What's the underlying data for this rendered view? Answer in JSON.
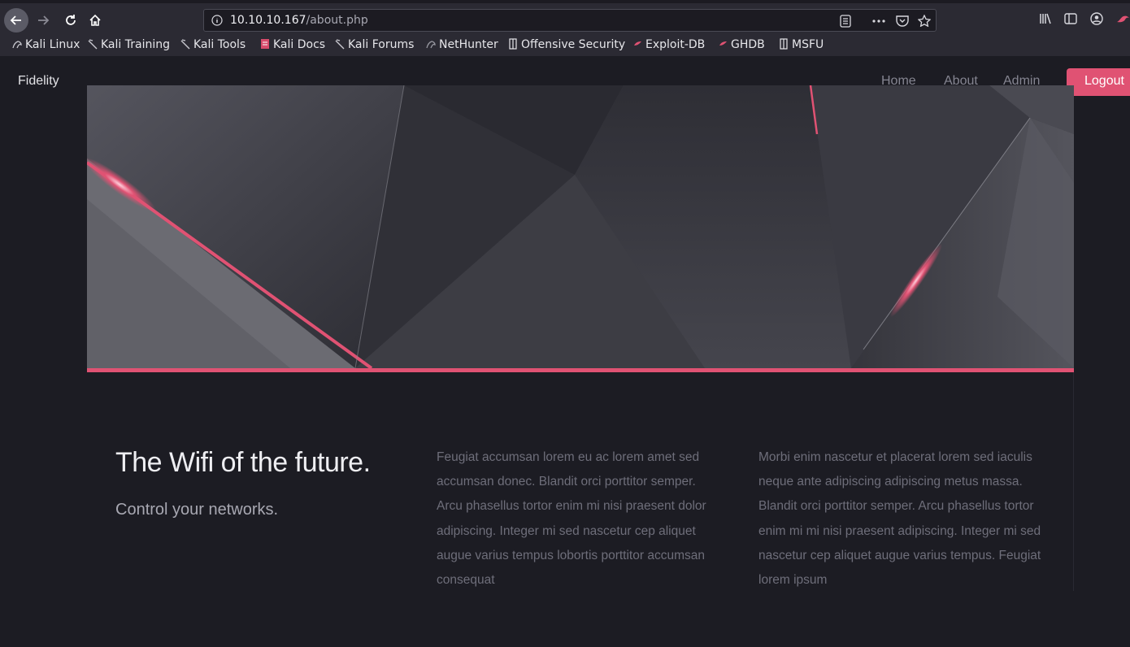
{
  "browser": {
    "url_host": "10.10.10.167",
    "url_path": "/about.php",
    "bookmarks": [
      {
        "label": "Kali Linux",
        "icon": "kali-dragon-icon"
      },
      {
        "label": "Kali Training",
        "icon": "kali-dragon-icon"
      },
      {
        "label": "Kali Tools",
        "icon": "kali-dragon-icon"
      },
      {
        "label": "Kali Docs",
        "icon": "kali-docs-icon"
      },
      {
        "label": "Kali Forums",
        "icon": "kali-dragon-icon"
      },
      {
        "label": "NetHunter",
        "icon": "nethunter-icon"
      },
      {
        "label": "Offensive Security",
        "icon": "offsec-icon"
      },
      {
        "label": "Exploit-DB",
        "icon": "exploit-db-icon"
      },
      {
        "label": "GHDB",
        "icon": "ghdb-icon"
      },
      {
        "label": "MSFU",
        "icon": "msfu-icon"
      }
    ]
  },
  "site": {
    "brand": "Fidelity",
    "nav": [
      "Home",
      "About",
      "Admin"
    ],
    "logout": "Logout",
    "accent": "#e05273"
  },
  "content": {
    "headline": "The Wifi of the future.",
    "subline": "Control your networks.",
    "paragraph1": "Feugiat accumsan lorem eu ac lorem amet sed accumsan donec. Blandit orci porttitor semper. Arcu phasellus tortor enim mi nisi praesent dolor adipiscing. Integer mi sed nascetur cep aliquet augue varius tempus lobortis porttitor accumsan consequat",
    "paragraph2": "Morbi enim nascetur et placerat lorem sed iaculis neque ante adipiscing adipiscing metus massa. Blandit orci porttitor semper. Arcu phasellus tortor enim mi mi nisi praesent adipiscing. Integer mi sed nascetur cep aliquet augue varius tempus. Feugiat lorem ipsum"
  }
}
